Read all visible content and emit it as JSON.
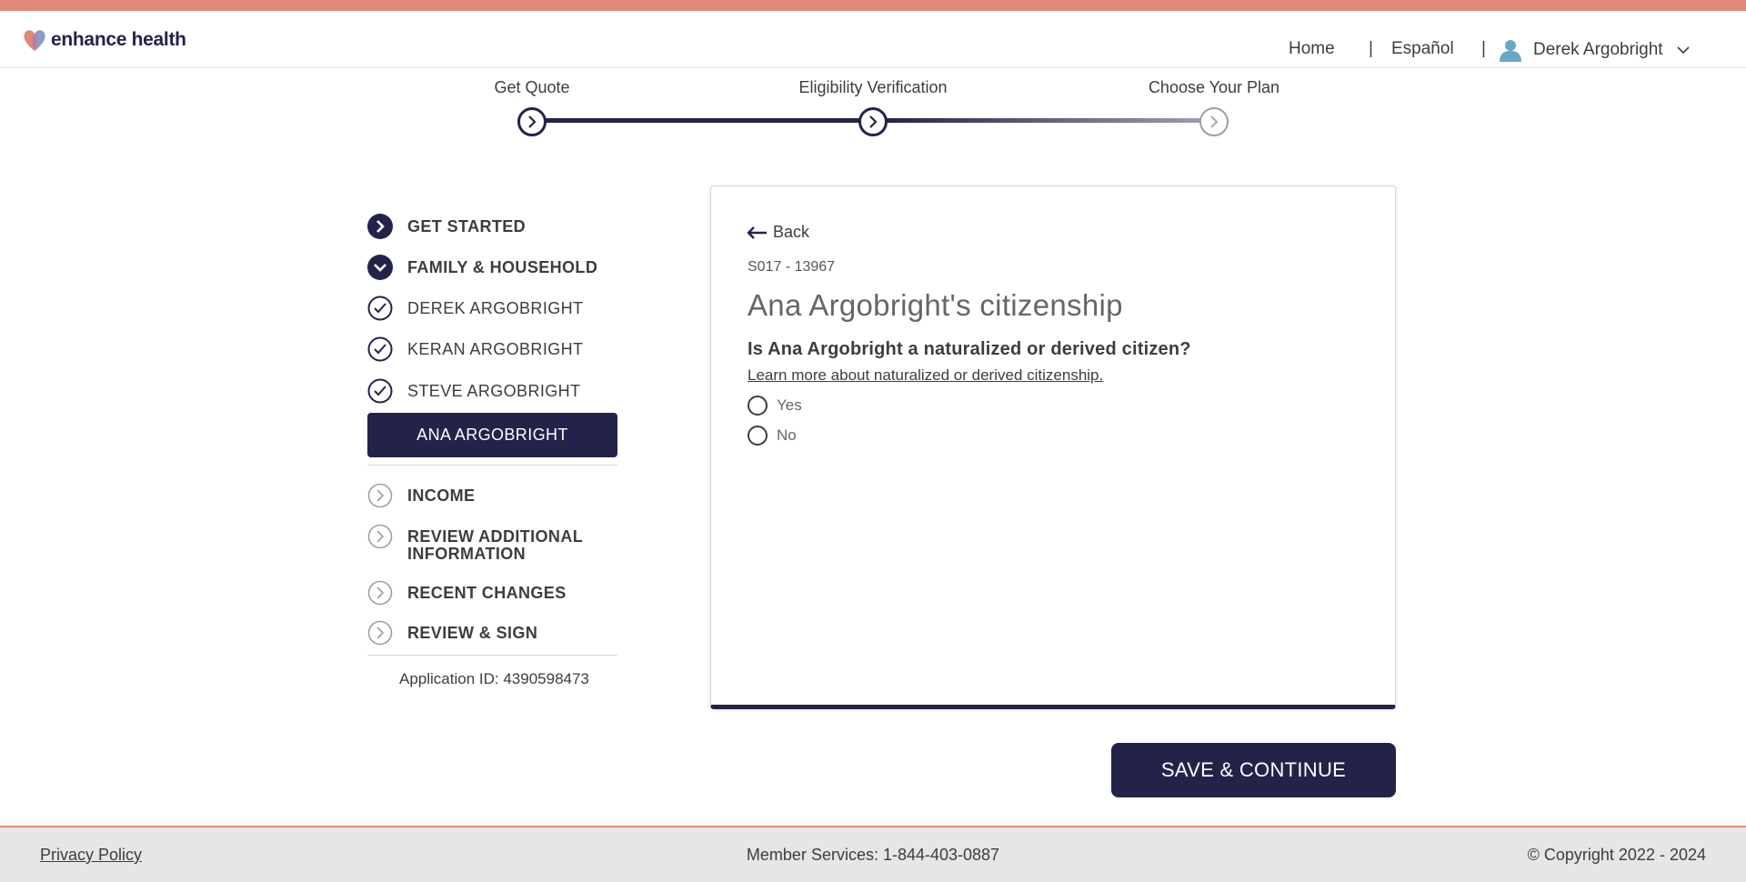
{
  "brand": {
    "name": "enhance health"
  },
  "nav": {
    "home": "Home",
    "separator": "|",
    "language": "Español",
    "user": "Derek Argobright"
  },
  "progress": {
    "steps": [
      {
        "label": "Get Quote"
      },
      {
        "label": "Eligibility Verification"
      },
      {
        "label": "Choose Your Plan"
      }
    ]
  },
  "sidebar": {
    "items": [
      {
        "label": "GET STARTED"
      },
      {
        "label": "FAMILY & HOUSEHOLD"
      },
      {
        "label": "DEREK ARGOBRIGHT"
      },
      {
        "label": "KERAN ARGOBRIGHT"
      },
      {
        "label": "STEVE ARGOBRIGHT"
      },
      {
        "label": "ANA ARGOBRIGHT"
      },
      {
        "label": "INCOME"
      },
      {
        "label": "REVIEW ADDITIONAL INFORMATION"
      },
      {
        "label": "RECENT CHANGES"
      },
      {
        "label": "REVIEW & SIGN"
      }
    ],
    "application_id": "Application ID: 4390598473"
  },
  "card": {
    "back": "Back",
    "code": "S017 - 13967",
    "title": "Ana Argobright's citizenship",
    "question": "Is Ana Argobright a naturalized or derived citizen?",
    "learn_more": "Learn more about naturalized or derived citizenship.",
    "options": [
      "Yes",
      "No"
    ]
  },
  "actions": {
    "save": "SAVE & CONTINUE"
  },
  "footer": {
    "privacy": "Privacy Policy",
    "member_services": "Member Services: 1-844-403-0887",
    "copyright": "© Copyright 2022 - 2024"
  },
  "colors": {
    "brand_navy": "#23234a",
    "accent_salmon": "#e08a78",
    "footer_bg": "#e6e6e6"
  }
}
